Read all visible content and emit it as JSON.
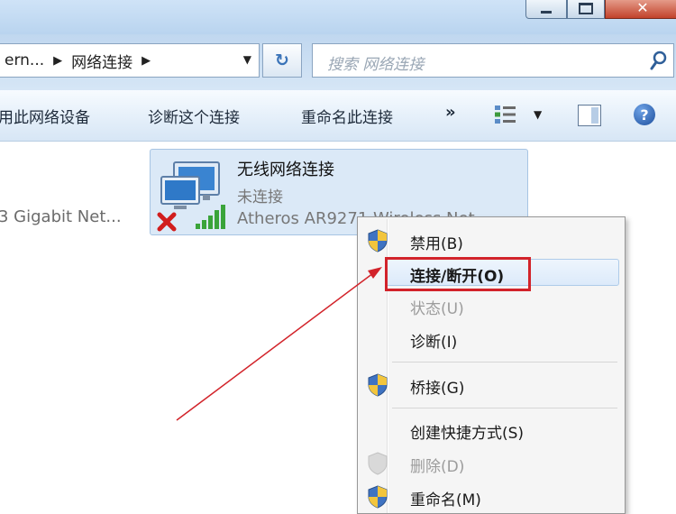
{
  "address": {
    "crumb_partial": "ern...",
    "crumb_current": "网络连接",
    "sep_glyph": "▶",
    "dropdown_glyph": "▼",
    "refresh_glyph": "↻"
  },
  "search": {
    "placeholder": "搜索 网络连接"
  },
  "toolbar": {
    "disable_device": "用此网络设备",
    "diagnose": "诊断这个连接",
    "rename": "重命名此连接",
    "more": "»",
    "help": "?"
  },
  "window_controls": {
    "close_glyph": "✕"
  },
  "adapters": {
    "left_partial": "3 Gigabit Net...",
    "wireless": {
      "name": "无线网络连接",
      "status": "未连接",
      "device": "Atheros AR9271 Wireless Net"
    }
  },
  "context_menu": {
    "items": [
      {
        "label": "禁用(B)",
        "shield": true,
        "disabled": false
      },
      {
        "label": "连接/断开(O)",
        "shield": false,
        "disabled": false,
        "highlighted": true
      },
      {
        "label": "状态(U)",
        "shield": false,
        "disabled": true
      },
      {
        "label": "诊断(I)",
        "shield": false,
        "disabled": false
      },
      {
        "label": "桥接(G)",
        "shield": true,
        "disabled": false
      },
      {
        "label": "创建快捷方式(S)",
        "shield": false,
        "disabled": false
      },
      {
        "label": "删除(D)",
        "shield": true,
        "disabled": true
      },
      {
        "label": "重命名(M)",
        "shield": true,
        "disabled": false
      }
    ]
  },
  "colors": {
    "annotation_red": "#d2232a",
    "selection_blue": "#dbe9f7"
  },
  "icons": [
    "minimize-icon",
    "maximize-icon",
    "close-icon",
    "refresh-icon",
    "search-icon",
    "view-options-icon",
    "preview-pane-icon",
    "help-icon",
    "network-adapter-icon",
    "disconnected-x-icon",
    "signal-bars-icon",
    "uac-shield-icon"
  ]
}
